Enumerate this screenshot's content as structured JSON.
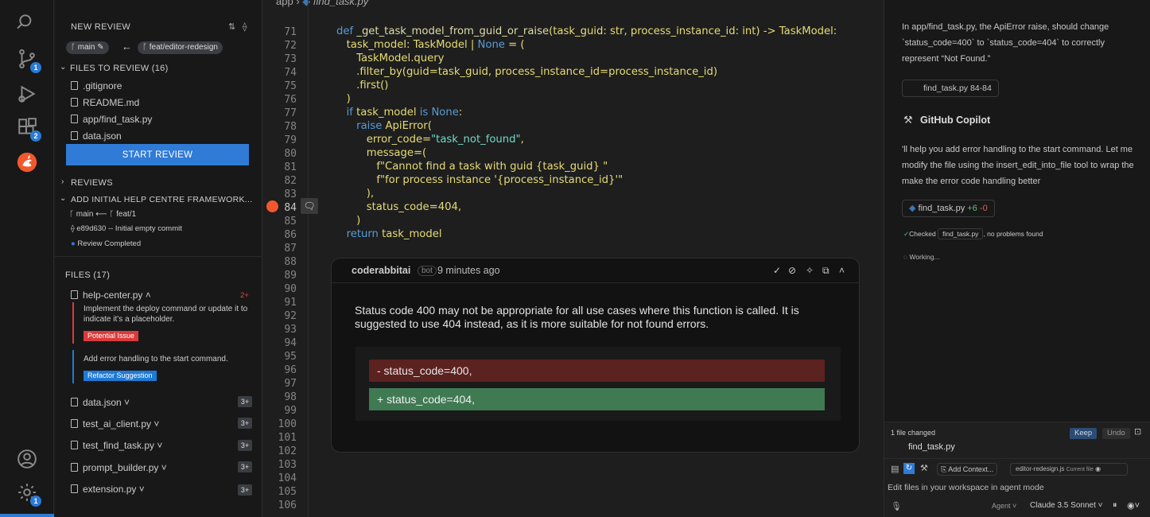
{
  "activity_bar": {
    "scm_badge": "1",
    "extensions_badge": "2",
    "settings_badge": "1"
  },
  "left_panel": {
    "new_review_title": "NEW REVIEW",
    "branch_main": "main",
    "branch_feature": "feat/editor-redesign",
    "files_to_review_title": "FILES TO REVIEW (16)",
    "files_to_review": [
      ".gitignore",
      "README.md",
      "app/find_task.py",
      "data.json"
    ],
    "start_review_label": "START REVIEW",
    "reviews_title": "REVIEWS",
    "review_item_title": "ADD INITIAL HELP CENTRE FRAMEWORK...",
    "review_branch_main": "main",
    "review_branch_feature": "feat/1",
    "review_commit": "e89d630 -- Initial empty commit",
    "review_status": "Review Completed",
    "files_title": "FILES (17)",
    "file_entries": [
      {
        "name": "help-center.py",
        "count": "2+"
      },
      {
        "name": "data.json",
        "count": "3+"
      },
      {
        "name": "test_ai_client.py",
        "count": "3+"
      },
      {
        "name": "test_find_task.py",
        "count": "3+"
      },
      {
        "name": "prompt_builder.py",
        "count": "3+"
      },
      {
        "name": "extension.py",
        "count": "3+"
      }
    ],
    "issue1_text": "Implement the deploy command or update it to indicate it’s a placeholder.",
    "issue1_tag": "Potential Issue",
    "issue2_text": "Add error handling to the start command.",
    "issue2_tag": "Refactor Suggestion"
  },
  "editor": {
    "breadcrumb_app": "app",
    "breadcrumb_file": "find_task.py",
    "line_numbers": [
      "71",
      "72",
      "73",
      "74",
      "75",
      "76",
      "77",
      "78",
      "79",
      "80",
      "81",
      "82",
      "83",
      "84",
      "85",
      "86",
      "87",
      "88",
      "89",
      "90",
      "91",
      "92",
      "93",
      "94",
      "95",
      "96",
      "97",
      "98",
      "99",
      "100",
      "101",
      "102",
      "103",
      "104",
      "105",
      "106"
    ],
    "comment": {
      "author": "coderabbitai",
      "bot_label": "bot",
      "time": "9 minutes ago",
      "body": "Status code 400 may not be appropriate for all use cases where this function is called. It is suggested to use 404 instead, as it is more suitable for not found errors.",
      "removed_line": "- status_code=400,",
      "added_line": "+ status_code=404,"
    }
  },
  "right_panel": {
    "intro_text": "In app/find_task.py, the ApiError raise, should change `status_code=400` to `status_code=404` to correctly represent “Not Found.”",
    "ref_chip": "find_task.py 84-84",
    "copilot_name": "GitHub Copilot",
    "copilot_message": "'ll help you add error handling to the start command. Let me modify the file using the insert_edit_into_file tool to wrap the make the error code handling better",
    "file_chip_name": "find_task.py",
    "file_chip_added": "+6",
    "file_chip_removed": "-0",
    "checked_prefix": "Checked",
    "checked_file": "find_task.py",
    "checked_suffix": ", no problems found",
    "working_label": "Working...",
    "changed_count": "1 file changed",
    "keep_label": "Keep",
    "undo_label": "Undo",
    "changed_file": "find_task.py",
    "add_context_label": "Add Context...",
    "current_file_name": "editor-redesign.js",
    "current_file_label": "Current file",
    "input_placeholder": "Edit files in your workspace in agent mode",
    "mode_label": "Agent",
    "model_label": "Claude 3.5 Sonnet"
  },
  "colors": {
    "accent_blue": "#2f7bd6",
    "removed_bg": "#5c2220",
    "added_bg": "#3f7a53",
    "potential_issue": "#d93b3b",
    "refactor": "#1f7ad6",
    "coderabbit_orange": "#f2572d"
  }
}
